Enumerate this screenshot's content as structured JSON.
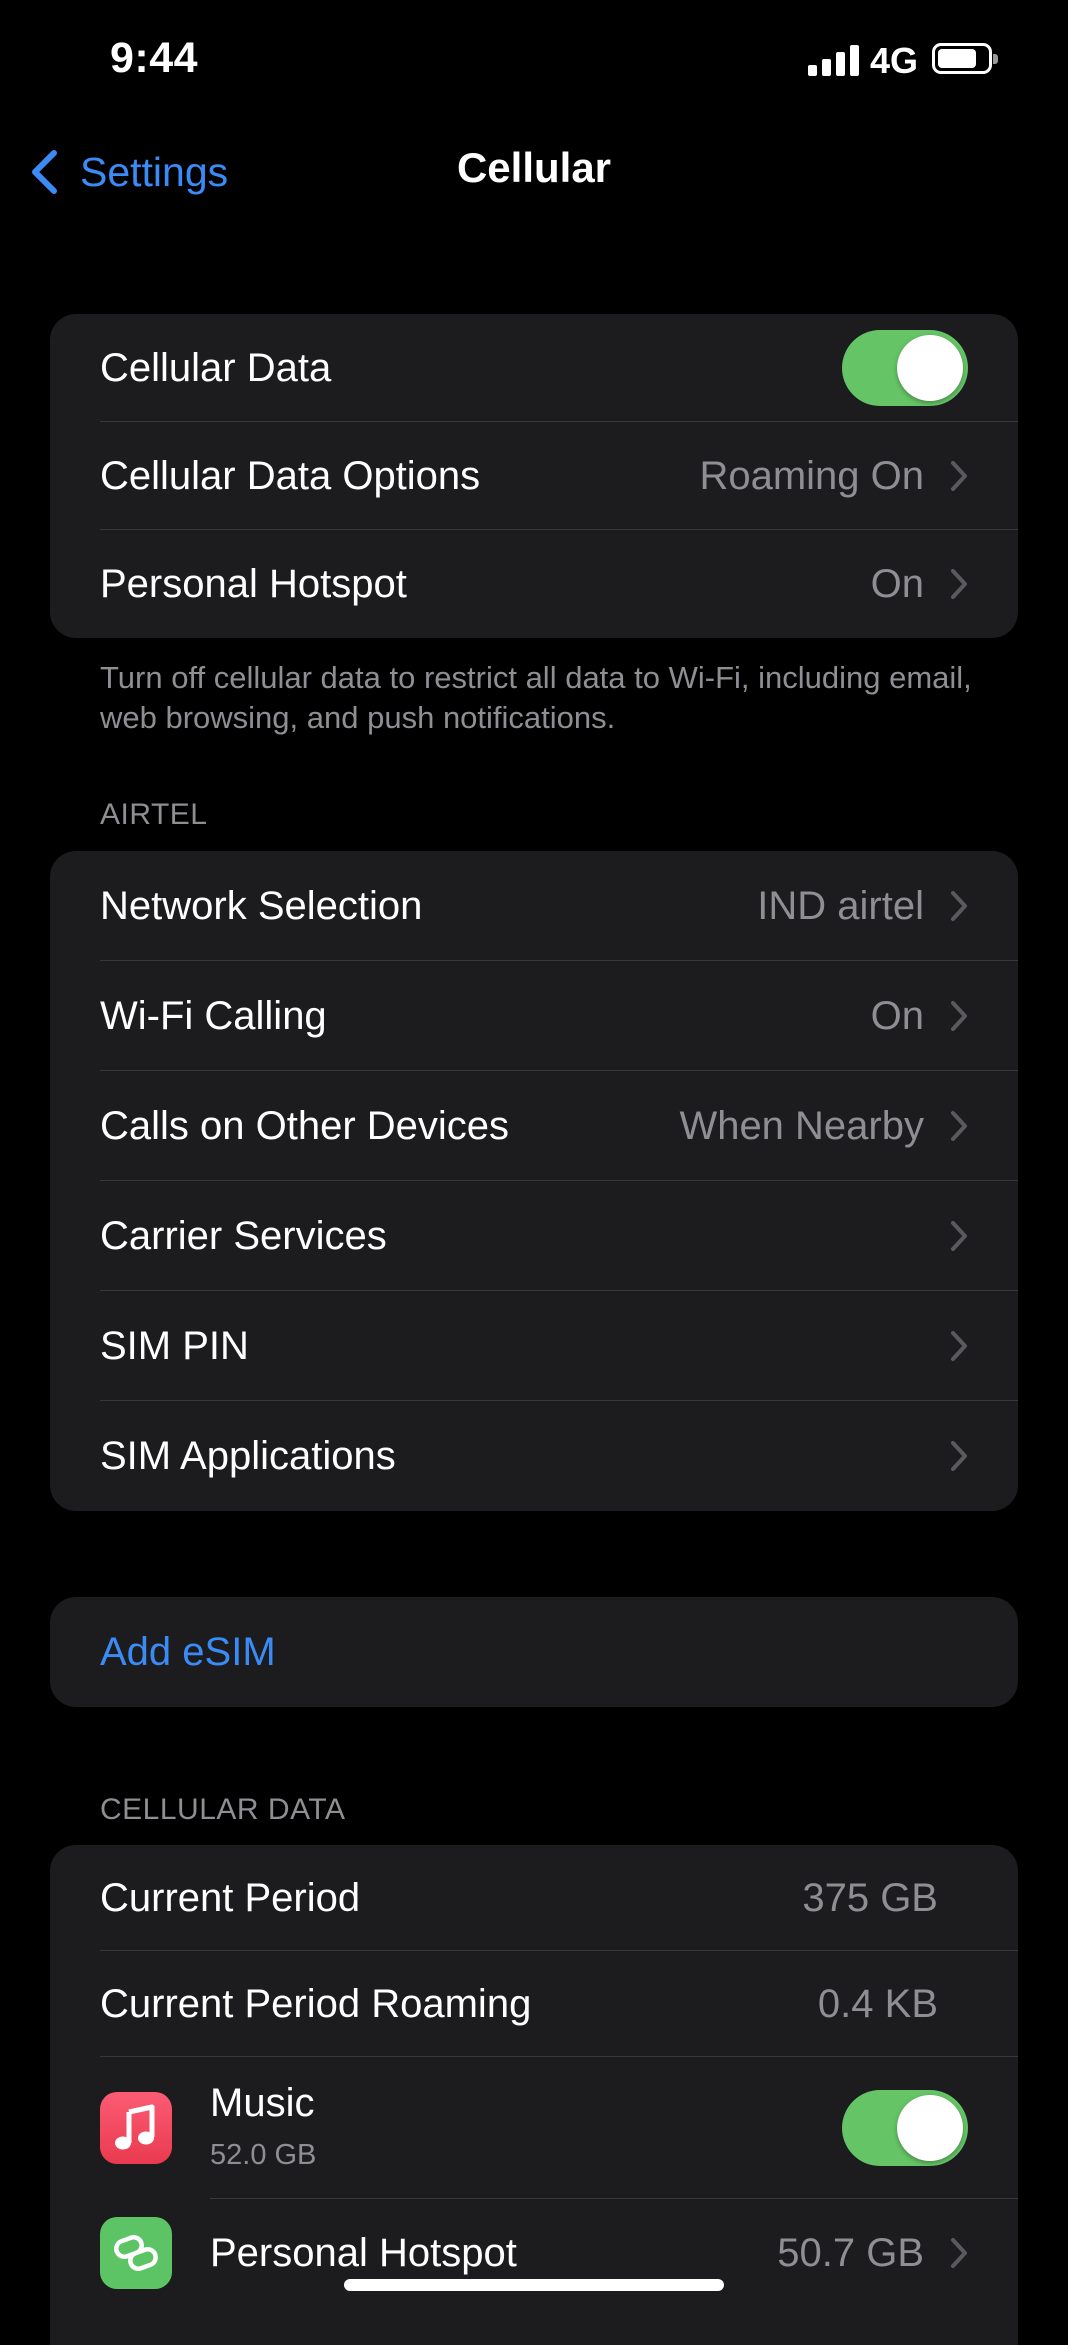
{
  "status_bar": {
    "time": "9:44",
    "network": "4G"
  },
  "nav": {
    "back_label": "Settings",
    "title": "Cellular"
  },
  "group1": {
    "cellular_data": {
      "label": "Cellular Data",
      "on": true
    },
    "cellular_data_options": {
      "label": "Cellular Data Options",
      "value": "Roaming On"
    },
    "personal_hotspot": {
      "label": "Personal Hotspot",
      "value": "On"
    },
    "footnote": "Turn off cellular data to restrict all data to Wi-Fi, including email, web browsing, and push notifications."
  },
  "carrier": {
    "header": "AIRTEL",
    "rows": [
      {
        "label": "Network Selection",
        "value": "IND airtel"
      },
      {
        "label": "Wi-Fi Calling",
        "value": "On"
      },
      {
        "label": "Calls on Other Devices",
        "value": "When Nearby"
      },
      {
        "label": "Carrier Services",
        "value": ""
      },
      {
        "label": "SIM PIN",
        "value": ""
      },
      {
        "label": "SIM Applications",
        "value": ""
      }
    ]
  },
  "esim": {
    "label": "Add eSIM"
  },
  "usage": {
    "header": "CELLULAR DATA",
    "current_period": {
      "label": "Current Period",
      "value": "375 GB"
    },
    "current_period_roaming": {
      "label": "Current Period Roaming",
      "value": "0.4 KB"
    },
    "apps": [
      {
        "label": "Music",
        "sub": "52.0 GB",
        "icon": "music-note-icon",
        "on": true
      },
      {
        "label": "Personal Hotspot",
        "value": "50.7 GB",
        "icon": "hotspot-link-icon"
      }
    ]
  },
  "colors": {
    "accent": "#3b8bf7",
    "toggle_on": "#65c466",
    "cell_bg": "#1c1c1e",
    "secondary_text": "#8e8e93"
  }
}
